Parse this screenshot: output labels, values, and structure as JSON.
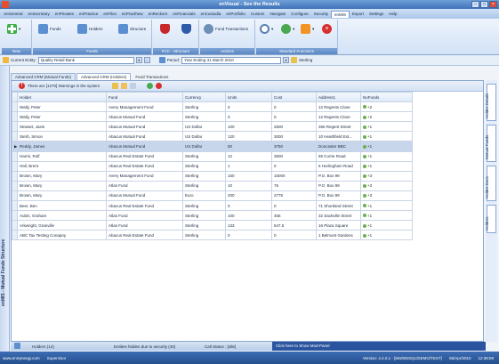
{
  "window": {
    "title": "enVisual - See the Results"
  },
  "menu": [
    "enGeneral",
    "enSecretary",
    "enPrivates",
    "enPractice",
    "enFiles",
    "enPracthew",
    "enReckonr",
    "enFinancials",
    "enCustodia",
    "enPortfolio",
    "Custom",
    "Navigate",
    "Configure",
    "Security",
    "enMIS",
    "Export",
    "Settings",
    "Help"
  ],
  "menu_active_index": 14,
  "ribbon": {
    "groups": [
      {
        "caption": "New",
        "buttons": [
          ""
        ]
      },
      {
        "caption": "Funds",
        "buttons": [
          "Funds",
          "Holders",
          "Structure"
        ]
      },
      {
        "caption": "FCC - Structure",
        "buttons": [
          "",
          ""
        ]
      },
      {
        "caption": "Actions",
        "buttons": [
          "Fund Transactions"
        ]
      },
      {
        "caption": "Standard Functions",
        "buttons": [
          "",
          "",
          "",
          ""
        ]
      }
    ]
  },
  "entitybar": {
    "entity_label": "Current Entity:",
    "entity_value": "Quality Retail Bank",
    "period_label": "Period:",
    "period_value": "Year Ending 31 March 2010",
    "currency": "Sterling"
  },
  "tabs": [
    "Advanced CRM (Mutual Funds)",
    "Advanced CRM (Holders)",
    "Fund Transactions"
  ],
  "tabs_active_index": 1,
  "left_panel_label": "enMIS - Mutual Funds Structure",
  "warning": {
    "text": "There are [1270] Warnings in the system"
  },
  "table": {
    "columns": [
      "Holder",
      "Fund",
      "Currency",
      "Units",
      "Cost",
      "Address1",
      "NoFunds"
    ],
    "rows": [
      [
        "Wally, Peter",
        "Avery Management Fund",
        "Sterling",
        "0",
        "0",
        "12 Regents Close",
        "2"
      ],
      [
        "Wally, Peter",
        "Abacus Mutual Fund",
        "Sterling",
        "0",
        "0",
        "12 Regents Close",
        "2"
      ],
      [
        "Stewart, Jasin",
        "Abacus Mutual Fund",
        "US Dollar",
        "100",
        "2500",
        "356 Regent Street",
        "1"
      ],
      [
        "Sterb, Simon",
        "Abacus Mutual Fund",
        "US Dollar",
        "120",
        "3000",
        "10 Heathfield Est...",
        "1"
      ],
      [
        "Reddy, James",
        "Abacus Mutual Fund",
        "US Dollar",
        "50",
        "3750",
        "Doncaster BBC",
        "1"
      ],
      [
        "Harris, Rolf",
        "Abacus Real Estate Fund",
        "Sterling",
        "12",
        "3600",
        "65 Corrie Road",
        "1"
      ],
      [
        "Hall, Brent",
        "Abacus Real Estate Fund",
        "Sterling",
        "1",
        "0",
        "6 Hurlingham Road",
        "1"
      ],
      [
        "Brown, Mary",
        "Avery Management Fund",
        "Sterling",
        "150",
        "15000",
        "P.O. Box 99",
        "3"
      ],
      [
        "Brown, Mary",
        "Atlas Fund",
        "Sterling",
        "10",
        "75",
        "P.O. Box 99",
        "3"
      ],
      [
        "Brown, Mary",
        "Abacus Mutual Fund",
        "Euro",
        "200",
        "2775",
        "P.O. Box 99",
        "3"
      ],
      [
        "Beer, Ben",
        "Abacus Real Estate Fund",
        "Sterling",
        "0",
        "0",
        "71 Shortland Street",
        "1"
      ],
      [
        "Aubin, Graham",
        "Atlas Fund",
        "Sterling",
        "100",
        "456",
        "32 Sackville Street",
        "1"
      ],
      [
        "Arkwright, Granville",
        "Atlas Fund",
        "Sterling",
        "133",
        "547.5",
        "16 Plaza Square",
        "1"
      ],
      [
        "ABC Tax Testing Conapny",
        "Abacus Real Estate Fund",
        "Sterling",
        "0",
        "0",
        "1 Belmont Gardens",
        "1"
      ]
    ],
    "selected_row": 4
  },
  "right_tabs": [
    "Holder Details",
    "Mutual Funds",
    "Holder Docs",
    "Holders"
  ],
  "status": {
    "holders": "Holders (14)",
    "hidden": "Entities hidden due to security (40)",
    "call": "Call Status : [Idle]",
    "show_panel": "Click here to Show Mod-Panel"
  },
  "footer": {
    "website": "www.enSynergy.com",
    "user": "Supervisor",
    "version": "Version: 4.4.0.1 - [MS/MSSQL/DEMO/TEST]",
    "date": "06/Apr/2010",
    "time": "12:38:59"
  },
  "colors": {
    "ribbon_caption": "#5b86c2",
    "selected_row": "#c8d6ec",
    "footer": "#2b5a9e",
    "status_panel": "#2b54a0"
  }
}
